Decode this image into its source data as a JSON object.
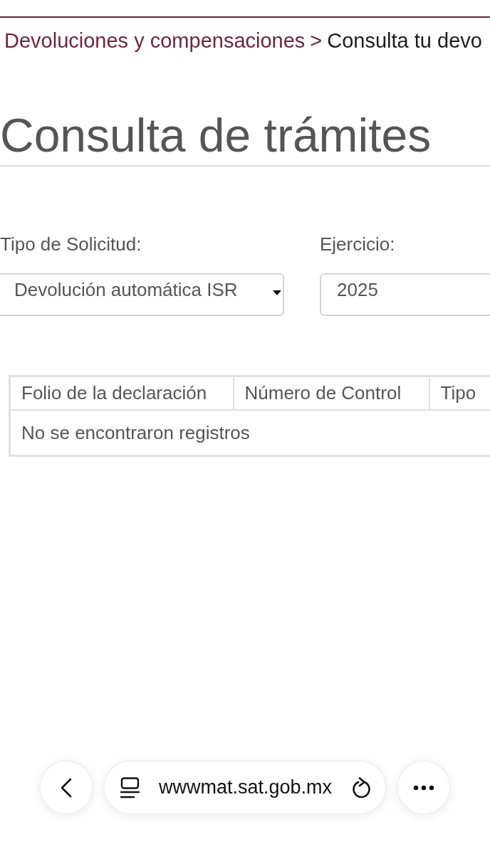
{
  "breadcrumb": {
    "items": [
      {
        "label": "Devoluciones y compensaciones",
        "kind": "link"
      },
      {
        "label": "Consulta tu devo",
        "kind": "current"
      }
    ],
    "separator": ">"
  },
  "page_title": "Consulta de trámites",
  "form": {
    "fields": [
      {
        "label": "Tipo de Solicitud:",
        "kind": "select",
        "value": "Devolución automática ISR"
      },
      {
        "label": "Ejercicio:",
        "kind": "input",
        "value": "2025"
      }
    ]
  },
  "table": {
    "columns": [
      "Folio de la declaración",
      "Número de Control",
      "Tipo"
    ],
    "empty_message": "No se encontraron registros"
  },
  "browser_toolbar": {
    "url": "wwwmat.sat.gob.mx"
  }
}
